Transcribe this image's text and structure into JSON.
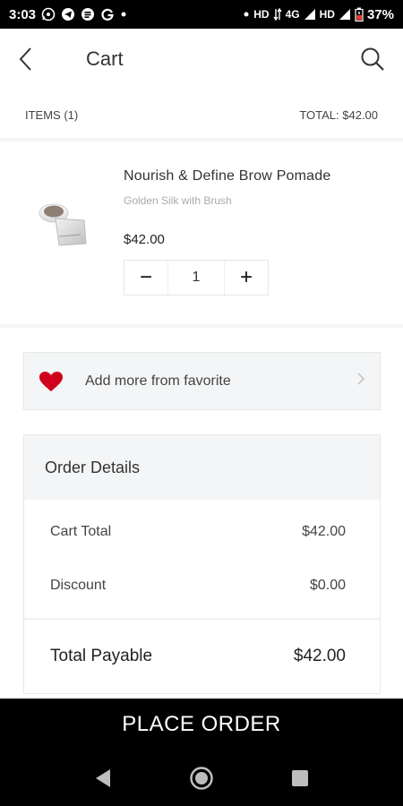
{
  "status_bar": {
    "time": "3:03",
    "network_label": "HD",
    "lte_label": "4G",
    "hd2_label": "HD",
    "battery": "37%",
    "icons": [
      "whatsapp-icon",
      "telegram-icon",
      "sms-icon",
      "google-icon",
      "dot-icon",
      "wifi-icon",
      "signal-icon",
      "battery-icon"
    ]
  },
  "header": {
    "title": "Cart",
    "back_icon": "chevron-left-icon",
    "search_icon": "search-icon"
  },
  "summary": {
    "items_label": "ITEMS (1)",
    "total_label": "TOTAL: $42.00"
  },
  "product": {
    "name": "Nourish & Define Brow Pomade",
    "variant": "Golden Silk with Brush",
    "price": "$42.00",
    "quantity": "1",
    "minus_symbol": "−",
    "plus_symbol": "+"
  },
  "favorite": {
    "label": "Add more from favorite",
    "heart_color": "#d0021b"
  },
  "order_details": {
    "title": "Order Details",
    "lines": [
      {
        "label": "Cart Total",
        "value": "$42.00"
      },
      {
        "label": "Discount",
        "value": "$0.00"
      }
    ],
    "total_label": "Total Payable",
    "total_value": "$42.00"
  },
  "place_order": {
    "label": "PLACE ORDER"
  },
  "nav_bar": {
    "icons": [
      "back-triangle-icon",
      "home-circle-icon",
      "recents-square-icon"
    ]
  }
}
